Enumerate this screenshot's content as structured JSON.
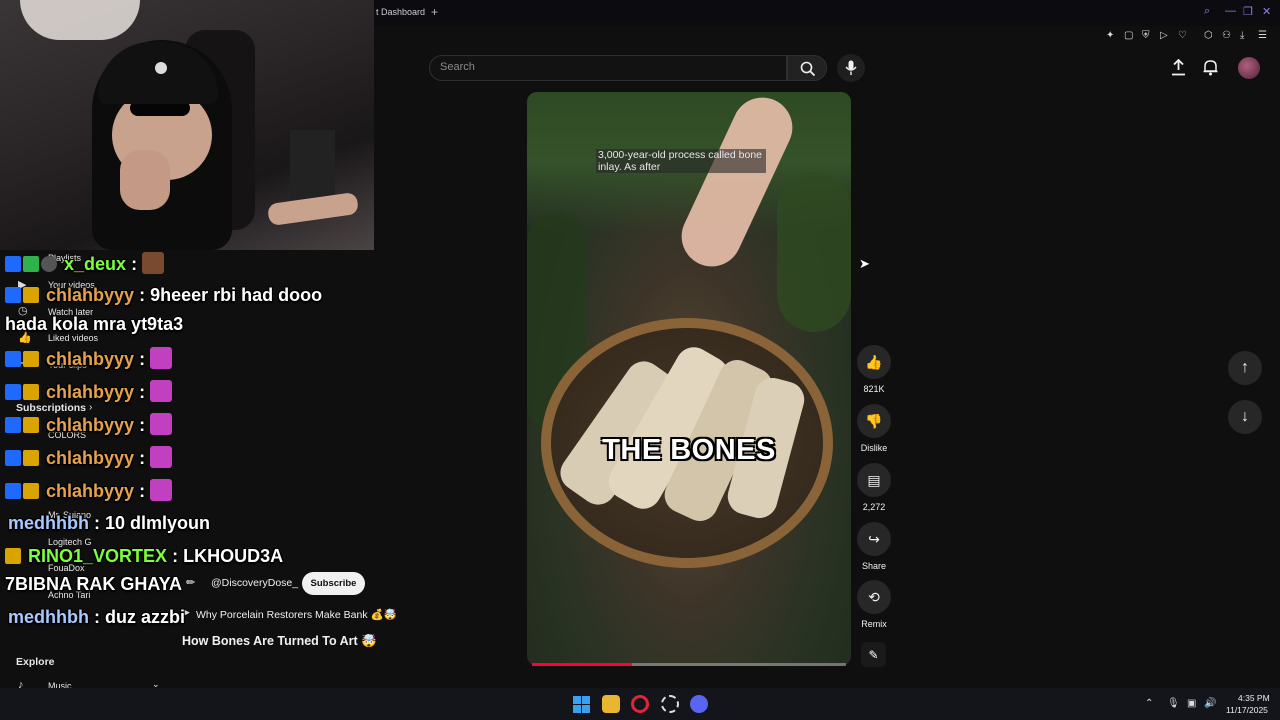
{
  "browser": {
    "tab_label": "t Dashboard",
    "new_tab": "+"
  },
  "header": {
    "search_placeholder": "Search"
  },
  "video": {
    "subtitle_text": "3,000-year-old process called bone inlay. As after",
    "caption": "THE BONES",
    "progress": 0.32
  },
  "actions": {
    "like_count": "821K",
    "dislike_label": "Dislike",
    "comments_count": "2,272",
    "share_label": "Share",
    "remix_label": "Remix"
  },
  "channel": {
    "name": "@DiscoveryDose_",
    "subscribe_label": "Subscribe",
    "linked_video": "Why Porcelain Restorers Make Bank 💰🤯",
    "short_title": "How Bones Are Turned To Art 🤯"
  },
  "sidebar": {
    "items": [
      {
        "label": "Playlists",
        "icon": "playlist-icon"
      },
      {
        "label": "Your videos",
        "icon": "video-icon"
      },
      {
        "label": "Watch later",
        "icon": "clock-icon"
      },
      {
        "label": "Liked videos",
        "icon": "thumbs-up-icon"
      },
      {
        "label": "Your clips",
        "icon": "scissors-icon"
      }
    ],
    "subscriptions_heading": "Subscriptions",
    "subscriptions": [
      {
        "label": "COLORS"
      },
      {
        "label": "Mr. Sujano"
      },
      {
        "label": "Logitech G"
      },
      {
        "label": "FouaDox"
      },
      {
        "label": "Achno Tari"
      }
    ],
    "explore_heading": "Explore",
    "explore_items": [
      {
        "label": "Music"
      }
    ]
  },
  "chat": [
    {
      "user": "x_deux",
      "text": ":",
      "color": "#7cff3c"
    },
    {
      "user": "chlahbyyy",
      "text": ": 9heeer rbi had dooo",
      "color": "#e6a24a"
    },
    {
      "user": "",
      "text": "hada kola mra yt9ta3",
      "color": "#ffffff"
    },
    {
      "user": "chlahbyyy",
      "text": ":",
      "color": "#e6a24a"
    },
    {
      "user": "chlahbyyy",
      "text": ":",
      "color": "#e6a24a"
    },
    {
      "user": "chlahbyyy",
      "text": ":",
      "color": "#e6a24a"
    },
    {
      "user": "chlahbyyy",
      "text": ":",
      "color": "#e6a24a"
    },
    {
      "user": "chlahbyyy",
      "text": ":",
      "color": "#e6a24a"
    },
    {
      "user": "medhhbh",
      "text": ": 10 dlmlyoun",
      "color": "#a8c8ff"
    },
    {
      "user": "RINO1_VORTEX",
      "text": ": LKHOUD3A",
      "color": "#7cff3c"
    },
    {
      "user": "",
      "text": "7BIBNA RAK GHAYA",
      "color": "#ffffff"
    },
    {
      "user": "medhhbh",
      "text": ": duz azzbi",
      "color": "#a8c8ff"
    }
  ],
  "taskbar": {
    "time": "4:35 PM",
    "date": "11/17/2025"
  },
  "colors": {
    "accent_red": "#ff0033",
    "twitch_purple": "#9a7cf0"
  }
}
